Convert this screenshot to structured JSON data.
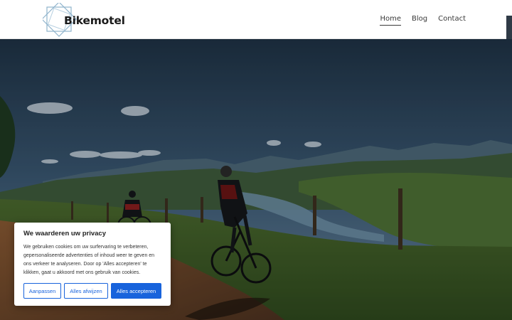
{
  "header": {
    "logo_text": "Bikemotel",
    "nav": [
      {
        "label": "Home",
        "active": true
      },
      {
        "label": "Blog",
        "active": false
      },
      {
        "label": "Contact",
        "active": false
      }
    ]
  },
  "hero": {
    "image": "mountain-bikers-on-dirt-road-landscape"
  },
  "cookie_banner": {
    "title": "We waarderen uw privacy",
    "text": "We gebruiken cookies om uw surfervaring te verbeteren, gepersonaliseerde advertenties of inhoud weer te geven en ons verkeer te analyseren. Door op 'Alles accepteren' te klikken, gaat u akkoord met ons gebruik van cookies.",
    "buttons": {
      "customize": "Aanpassen",
      "reject": "Alles afwijzen",
      "accept": "Alles accepteren"
    },
    "accent_color": "#1863dc"
  }
}
